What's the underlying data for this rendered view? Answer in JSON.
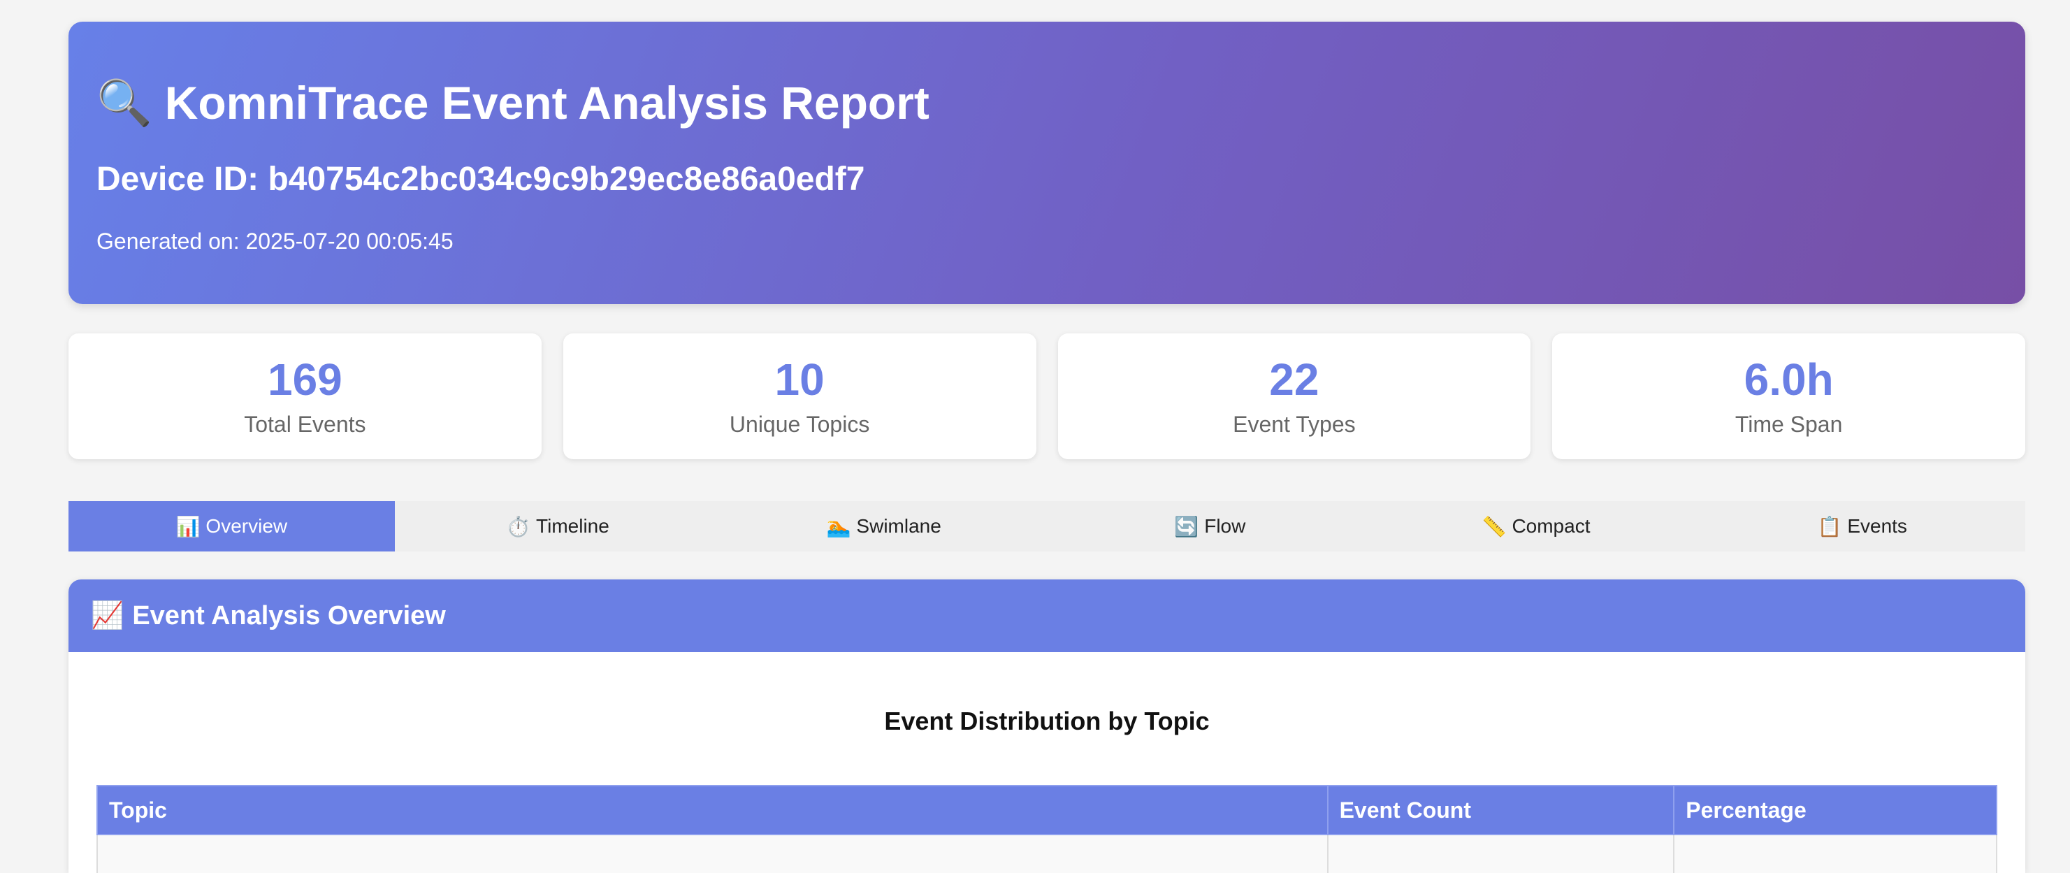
{
  "header": {
    "icon": "magnifier-icon",
    "title": "KomniTrace Event Analysis Report",
    "device": "Device ID: b40754c2bc034c9c9b29ec8e86a0edf7",
    "generated": "Generated on: 2025-07-20 00:05:45"
  },
  "stats": [
    {
      "value": "169",
      "label": "Total Events"
    },
    {
      "value": "10",
      "label": "Unique Topics"
    },
    {
      "value": "22",
      "label": "Event Types"
    },
    {
      "value": "6.0h",
      "label": "Time Span"
    }
  ],
  "tabs": [
    {
      "icon": "📊",
      "label": "Overview",
      "active": true
    },
    {
      "icon": "⏱️",
      "label": "Timeline"
    },
    {
      "icon": "🏊",
      "label": "Swimlane"
    },
    {
      "icon": "🔄",
      "label": "Flow"
    },
    {
      "icon": "📏",
      "label": "Compact"
    },
    {
      "icon": "📋",
      "label": "Events"
    }
  ],
  "panel": {
    "icon": "📈",
    "title": "Event Analysis Overview",
    "chart_title": "Event Distribution by Topic",
    "columns": [
      "Topic",
      "Event Count",
      "Percentage"
    ]
  },
  "colors": {
    "accent": "#6a7fe4",
    "header_gradient_start": "#6780e8",
    "header_gradient_end": "#774fa6"
  }
}
